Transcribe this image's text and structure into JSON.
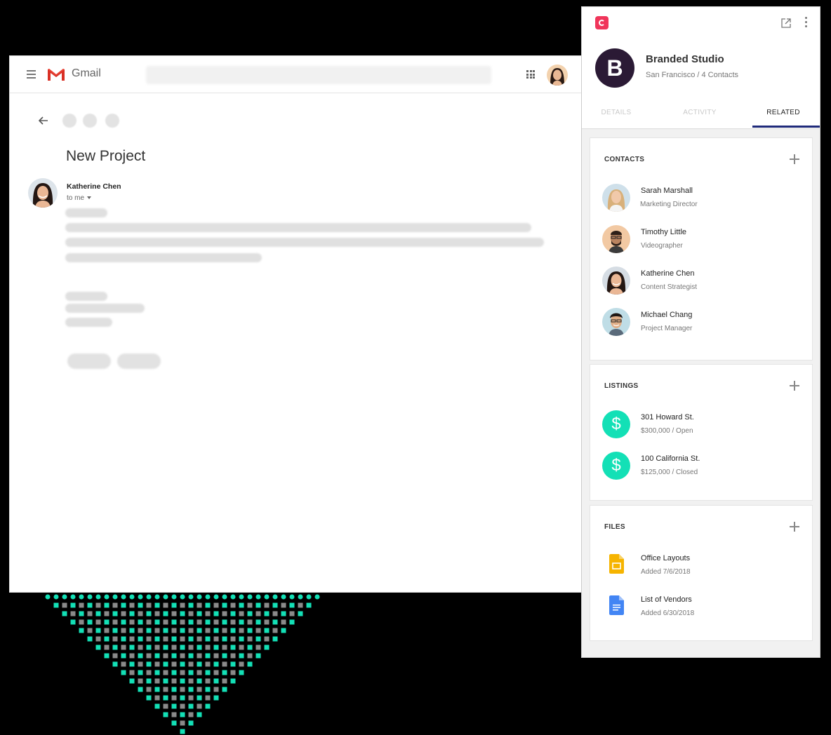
{
  "gmail": {
    "app_name": "Gmail",
    "email": {
      "subject": "New Project",
      "sender": "Katherine Chen",
      "recipient": "to me"
    }
  },
  "panel": {
    "company": {
      "initial": "B",
      "name": "Branded Studio",
      "subtitle": "San Francisco / 4 Contacts"
    },
    "tabs": [
      {
        "label": "DETAILS"
      },
      {
        "label": "ACTIVITY"
      },
      {
        "label": "RELATED"
      }
    ],
    "active_tab": "RELATED",
    "contacts": {
      "title": "CONTACTS",
      "items": [
        {
          "name": "Sarah Marshall",
          "role": "Marketing Director"
        },
        {
          "name": "Timothy Little",
          "role": "Videographer"
        },
        {
          "name": "Katherine Chen",
          "role": "Content Strategist"
        },
        {
          "name": "Michael Chang",
          "role": "Project Manager"
        }
      ]
    },
    "listings": {
      "title": "LISTINGS",
      "icon_glyph": "$",
      "items": [
        {
          "name": "301 Howard St.",
          "detail": "$300,000 / Open"
        },
        {
          "name": "100 California St.",
          "detail": "$125,000 / Closed"
        }
      ]
    },
    "files": {
      "title": "FILES",
      "items": [
        {
          "name": "Office Layouts",
          "detail": "Added 7/6/2018",
          "icon": "google-slides-icon"
        },
        {
          "name": "List of Vendors",
          "detail": "Added 6/30/2018",
          "icon": "google-docs-icon"
        }
      ]
    }
  },
  "colors": {
    "accent_dark": "#2b1a35",
    "tab_underline": "#1f2a7a",
    "listing_green": "#13e0b6",
    "brand_pink": "#f0355a",
    "slides_yellow": "#f6b400",
    "docs_blue": "#4285f4"
  }
}
